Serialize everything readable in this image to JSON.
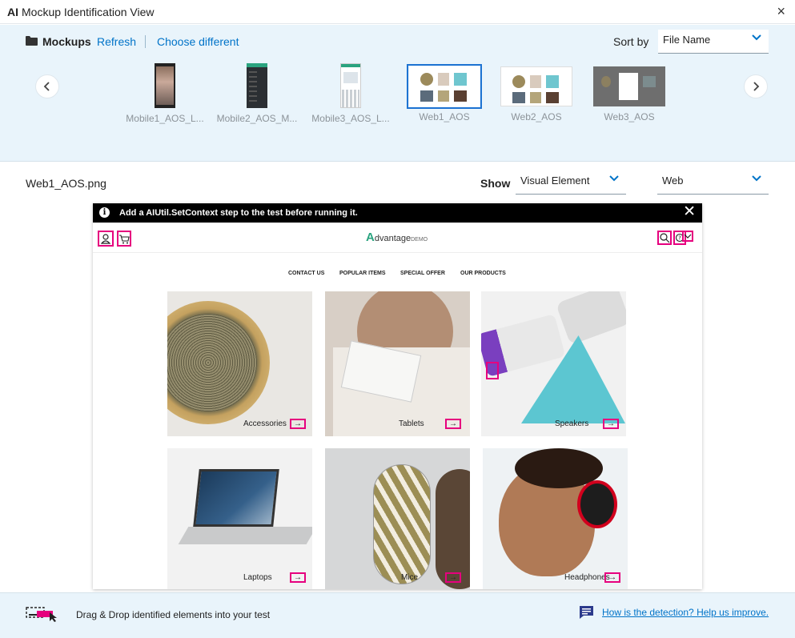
{
  "window": {
    "title_bold": "AI",
    "title": "Mockup Identification View",
    "close_glyph": "×"
  },
  "mockups": {
    "label": "Mockups",
    "refresh": "Refresh",
    "choose": "Choose different",
    "sort_label": "Sort by",
    "sort_value": "File Name",
    "thumbnails": [
      {
        "name": "Mobile1_AOS_L...",
        "selected": false
      },
      {
        "name": "Mobile2_AOS_M...",
        "selected": false
      },
      {
        "name": "Mobile3_AOS_L...",
        "selected": false
      },
      {
        "name": "Web1_AOS",
        "selected": true
      },
      {
        "name": "Web2_AOS",
        "selected": false
      },
      {
        "name": "Web3_AOS",
        "selected": false
      }
    ]
  },
  "view": {
    "filename": "Web1_AOS.png",
    "show_label": "Show",
    "show_value": "Visual Element",
    "platform_value": "Web"
  },
  "preview": {
    "banner_icon": "i",
    "banner": "Add a AIUtil.SetContext step to the test before running it.",
    "banner_close": "✕",
    "logo_letter": "A",
    "logo_text": "dvantage",
    "logo_demo": "DEMO",
    "nav": [
      "CONTACT US",
      "POPULAR ITEMS",
      "SPECIAL OFFER",
      "OUR PRODUCTS"
    ],
    "categories": [
      "Accessories",
      "Tablets",
      "Speakers",
      "Laptops",
      "Mice",
      "Headphones"
    ],
    "arrow": "→"
  },
  "footer": {
    "drag_text": "Drag & Drop identified elements into your test",
    "feedback": "How is the detection? Help us improve."
  },
  "colors": {
    "accent": "#0073c8",
    "highlight": "#e6007e",
    "panel_bg": "#e9f4fb"
  }
}
